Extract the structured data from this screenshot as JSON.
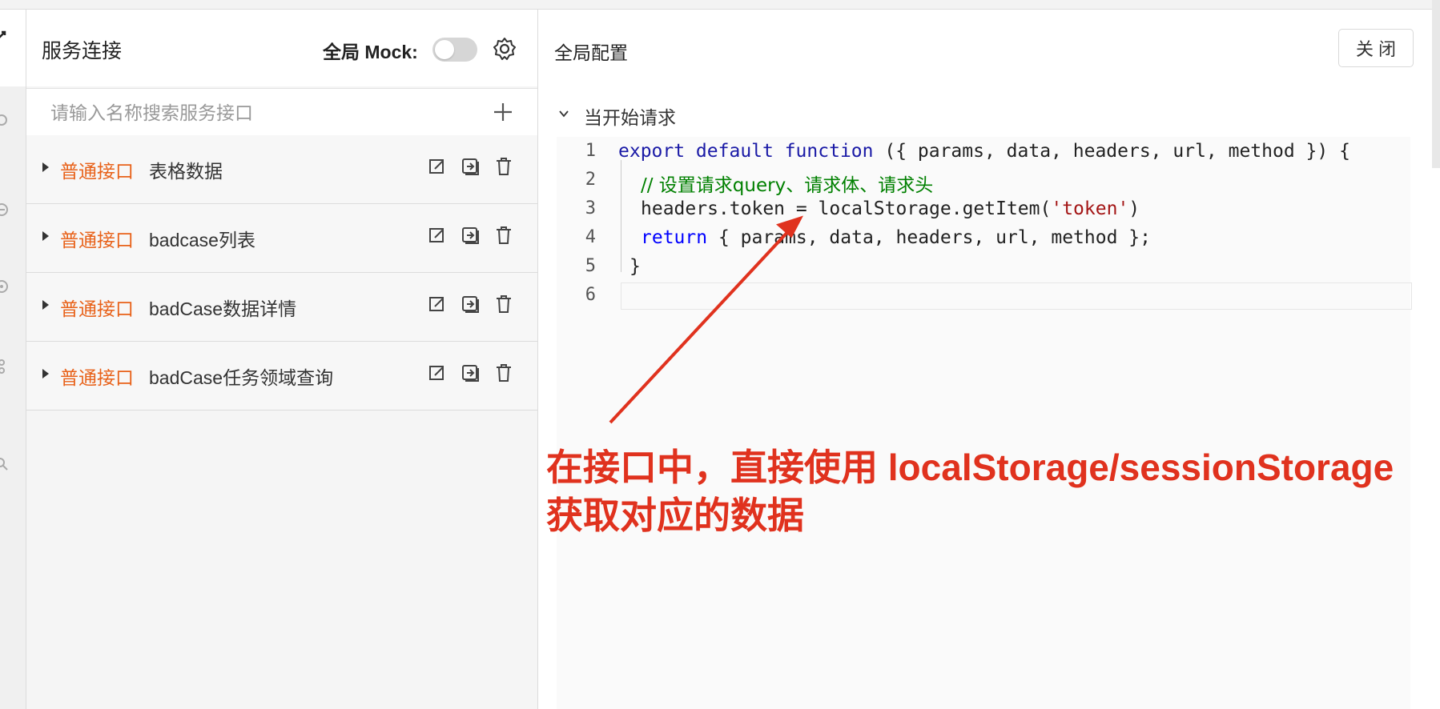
{
  "panel": {
    "title": "服务连接",
    "mock_label": "全局 Mock:",
    "mock_enabled": false,
    "search_placeholder": "请输入名称搜索服务接口"
  },
  "interfaces": [
    {
      "type": "普通接口",
      "name": "表格数据"
    },
    {
      "type": "普通接口",
      "name": "badcase列表"
    },
    {
      "type": "普通接口",
      "name": "badCase数据详情"
    },
    {
      "type": "普通接口",
      "name": "badCase任务领域查询"
    }
  ],
  "config": {
    "title": "全局配置",
    "close_label": "关闭",
    "section_label": "当开始请求"
  },
  "code": {
    "line_numbers": [
      "1",
      "2",
      "3",
      "4",
      "5",
      "6"
    ],
    "line1_kw": "export default function",
    "line1_rest": " ({ params, data, headers, url, method }) {",
    "line2_comment": "// 设置请求query、请求体、请求头",
    "line3_a": "headers.token = localStorage.getItem(",
    "line3_str": "'token'",
    "line3_b": ")",
    "line4_kw": "return",
    "line4_rest": " { params, data, headers, url, method };",
    "line5": "}"
  },
  "annotation": {
    "line1": "在接口中，直接使用 localStorage/sessionStorage",
    "line2": "获取对应的数据"
  },
  "colors": {
    "type_tag": "#e8621a",
    "annotation": "#e0321e"
  }
}
